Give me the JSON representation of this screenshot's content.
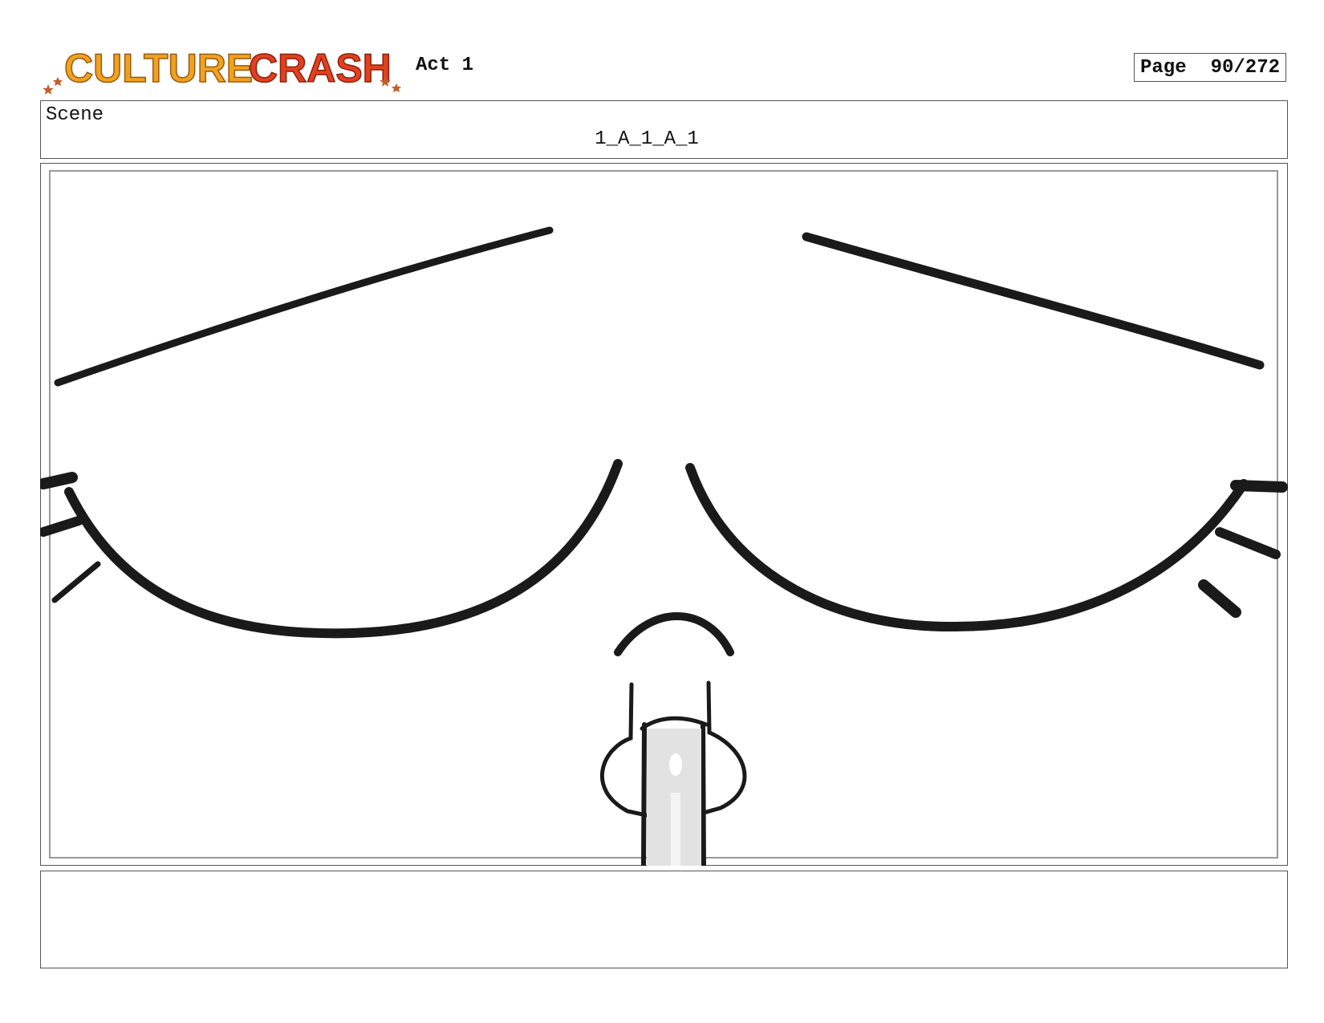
{
  "header": {
    "logo_text": "CULTURE CRASH",
    "act": "Act 1",
    "page_label": "Page",
    "page_number": "90/272"
  },
  "scene": {
    "label": "Scene",
    "id": "1_A_1_A_1"
  },
  "notes": {
    "text": ""
  },
  "colors": {
    "logo_orange": "#F0A21E",
    "logo_red": "#E2401E",
    "ink": "#1a1a1a",
    "shading": "#e2e2e2"
  }
}
